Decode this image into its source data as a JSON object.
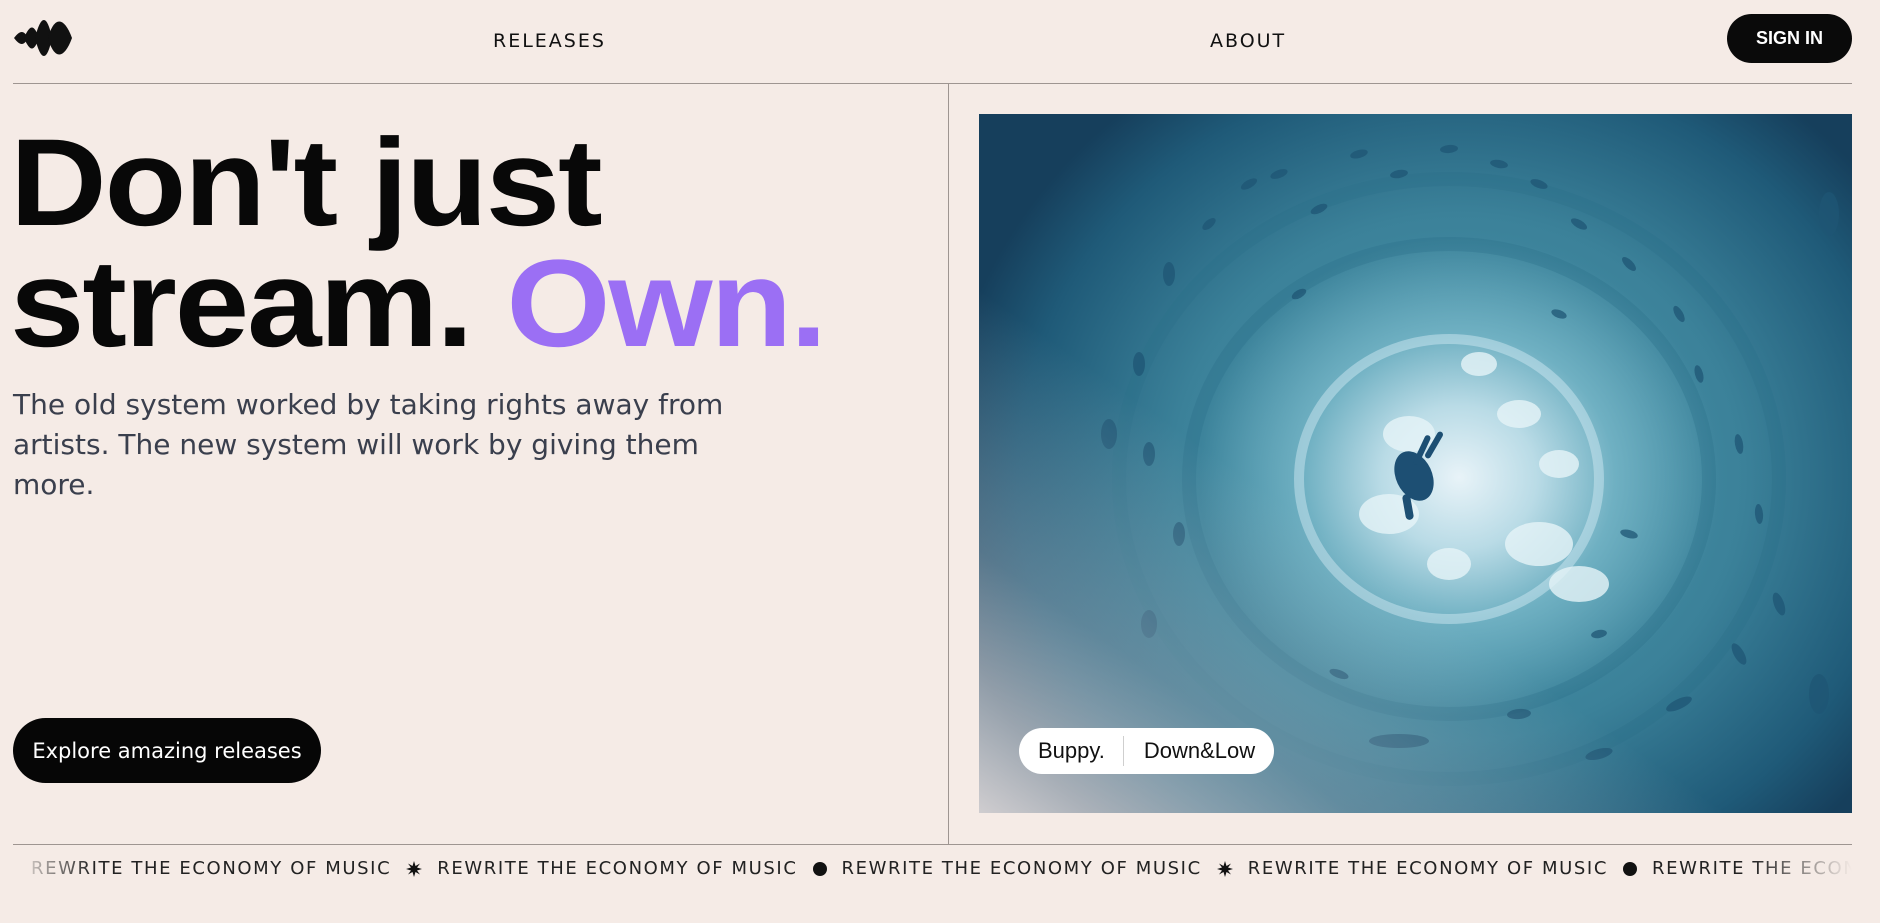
{
  "header": {
    "logo_icon": "sound-wave-logo-icon",
    "nav": [
      {
        "label": "RELEASES"
      },
      {
        "label": "ABOUT"
      }
    ],
    "signin_label": "SIGN IN"
  },
  "hero": {
    "title_line1": "Don't just",
    "title_line2_main": "stream.",
    "title_line2_accent": "Own.",
    "subtitle": "The old system worked by taking rights away from artists. The new system will work by giving them more.",
    "cta_label": "Explore amazing releases"
  },
  "artwork": {
    "description_icon": "featured-artwork-image",
    "artist": "Buppy.",
    "track": "Down&Low"
  },
  "marquee": {
    "text": "REWRITE THE ECONOMY OF MUSIC",
    "separators": [
      "star",
      "dot",
      "star",
      "dot"
    ]
  },
  "colors": {
    "background": "#f5ebe6",
    "accent": "#9b6ff4",
    "button": "#0a0a0a",
    "text": "#0b0b0b"
  }
}
